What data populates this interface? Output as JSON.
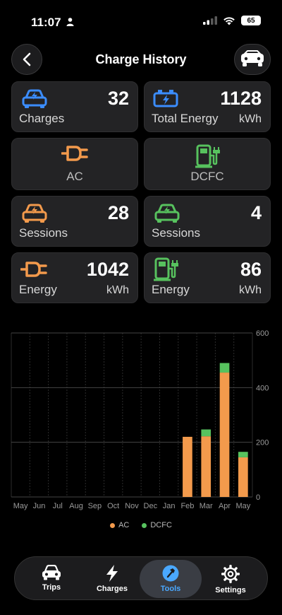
{
  "status": {
    "time": "11:07",
    "battery": "65"
  },
  "header": {
    "title": "Charge History"
  },
  "colors": {
    "blue": "#3b8dff",
    "orange": "#f39a4c",
    "green": "#57c25e"
  },
  "cards": {
    "charges": {
      "value": "32",
      "label": "Charges"
    },
    "total_energy": {
      "value": "1128",
      "label": "Total Energy",
      "unit": "kWh"
    },
    "ac": {
      "label": "AC"
    },
    "dcfc": {
      "label": "DCFC"
    },
    "ac_sessions": {
      "value": "28",
      "label": "Sessions"
    },
    "dc_sessions": {
      "value": "4",
      "label": "Sessions"
    },
    "ac_energy": {
      "value": "1042",
      "label": "Energy",
      "unit": "kWh"
    },
    "dc_energy": {
      "value": "86",
      "label": "Energy",
      "unit": "kWh"
    }
  },
  "chart_data": {
    "type": "bar",
    "stacked": true,
    "categories": [
      "May",
      "Jun",
      "Jul",
      "Aug",
      "Sep",
      "Oct",
      "Nov",
      "Dec",
      "Jan",
      "Feb",
      "Mar",
      "Apr",
      "May"
    ],
    "series": [
      {
        "name": "AC",
        "color": "#f39a4c",
        "values": [
          0,
          0,
          0,
          0,
          0,
          0,
          0,
          0,
          0,
          220,
          222,
          455,
          145
        ]
      },
      {
        "name": "DCFC",
        "color": "#57c25e",
        "values": [
          0,
          0,
          0,
          0,
          0,
          0,
          0,
          0,
          0,
          0,
          25,
          35,
          20
        ]
      }
    ],
    "yticks": [
      "0",
      "200",
      "400",
      "600"
    ],
    "ylim": [
      0,
      600
    ],
    "grid": true,
    "legend": "bottom"
  },
  "legend": {
    "ac": "AC",
    "dcfc": "DCFC"
  },
  "tabs": [
    {
      "label": "Trips"
    },
    {
      "label": "Charges"
    },
    {
      "label": "Tools"
    },
    {
      "label": "Settings"
    }
  ]
}
